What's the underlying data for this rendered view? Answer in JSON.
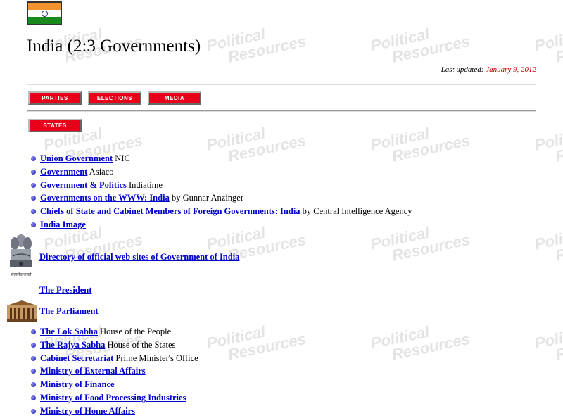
{
  "page": {
    "title": "India (2:3 Governments)",
    "last_updated_label": "Last updated:",
    "last_updated_date": "January 9, 2012"
  },
  "watermark": {
    "line1": "Political",
    "line2": "Resources"
  },
  "nav": {
    "buttons": [
      "PARTIES",
      "ELECTIONS",
      "MEDIA"
    ],
    "states": "STATES"
  },
  "links": [
    {
      "text": "Union Government",
      "desc": "NIC"
    },
    {
      "text": "Government",
      "desc": "Asiaco"
    },
    {
      "text": "Government & Politics",
      "desc": "Indiatime"
    },
    {
      "text": "Governments on the WWW: India",
      "desc": "by Gunnar Anzinger"
    },
    {
      "text": "Chiefs of State and Cabinet Members of Foreign Governments: India",
      "desc": "by Central Intelligence Agency"
    },
    {
      "text": "India Image",
      "desc": ""
    }
  ],
  "directory": {
    "text": "Directory of official web sites of Government of India",
    "emblem_caption": "सत्यमेव जयते"
  },
  "president": {
    "text": "The President"
  },
  "parliament": {
    "text": "The Parliament"
  },
  "links2": [
    {
      "text": "The Lok Sabha",
      "desc": "House of the People"
    },
    {
      "text": "The Rajya Sabha",
      "desc": "House of the States"
    },
    {
      "text": "Cabinet Secretariat",
      "desc": "Prime Minister's Office"
    },
    {
      "text": "Ministry of External Affairs",
      "desc": ""
    },
    {
      "text": "Ministry of Finance",
      "desc": ""
    },
    {
      "text": "Ministry of Food Processing Industries",
      "desc": ""
    },
    {
      "text": "Ministry of Home Affairs",
      "desc": ""
    }
  ]
}
